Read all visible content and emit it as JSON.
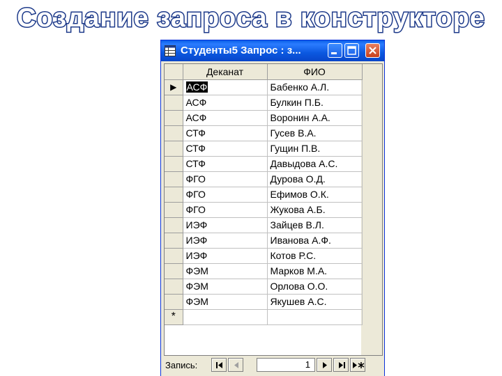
{
  "slide": {
    "title": "Создание запроса в конструкторе"
  },
  "window": {
    "title": "Студенты5 Запрос : з...",
    "buttons": {
      "minimize": "minimize",
      "maximize": "maximize",
      "close": "close"
    }
  },
  "table": {
    "columns": [
      "Деканат",
      "ФИО"
    ],
    "rows": [
      [
        "АСФ",
        "Бабенко А.Л."
      ],
      [
        "АСФ",
        "Булкин П.Б."
      ],
      [
        "АСФ",
        "Воронин А.А."
      ],
      [
        "СТФ",
        "Гусев В.А."
      ],
      [
        "СТФ",
        "Гущин П.В."
      ],
      [
        "СТФ",
        "Давыдова А.С."
      ],
      [
        "ФГО",
        "Дурова О.Д."
      ],
      [
        "ФГО",
        "Ефимов О.К."
      ],
      [
        "ФГО",
        "Жукова А.Б."
      ],
      [
        "ИЭФ",
        "Зайцев В.Л."
      ],
      [
        "ИЭФ",
        "Иванова А.Ф."
      ],
      [
        "ИЭФ",
        "Котов Р.С."
      ],
      [
        "ФЭМ",
        "Марков М.А."
      ],
      [
        "ФЭМ",
        "Орлова О.О."
      ],
      [
        "ФЭМ",
        "Якушев А.С."
      ]
    ],
    "current_row_marker": "▶",
    "new_row_marker": "*"
  },
  "navigation": {
    "label": "Запись:",
    "current_record": "1"
  },
  "colors": {
    "titlebar": "#0b58e0",
    "title_outline": "#1d3a8a",
    "selection": "#000000"
  }
}
